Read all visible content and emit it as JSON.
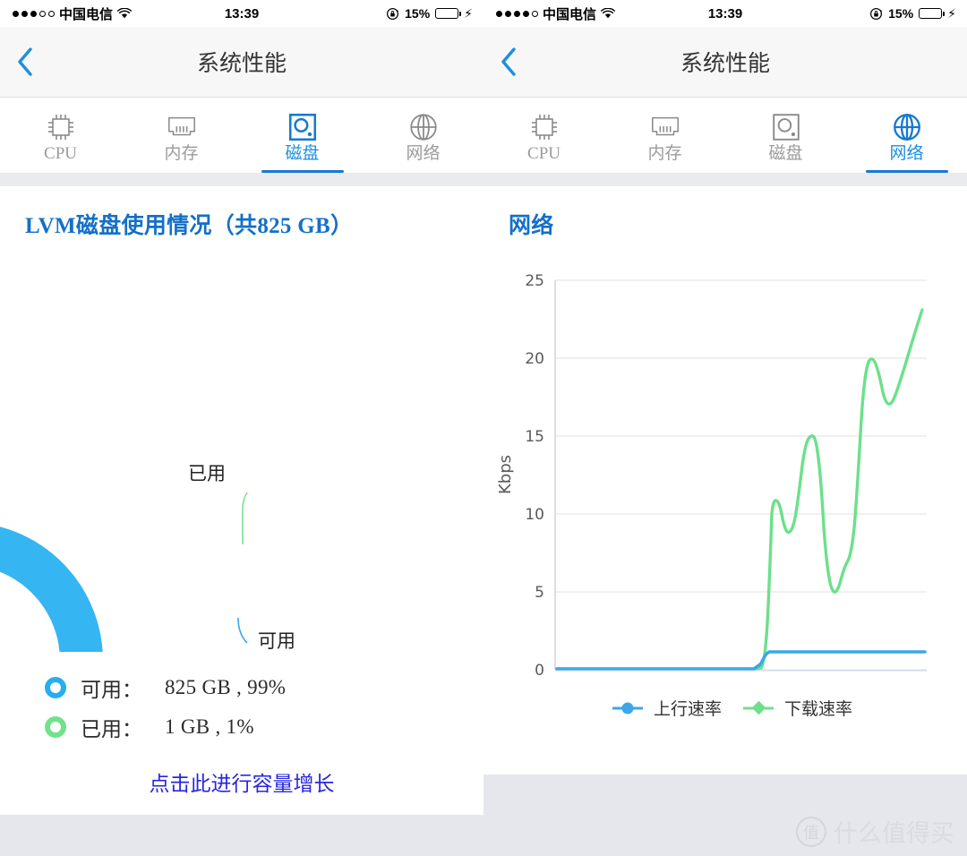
{
  "left": {
    "statusbar": {
      "signal_dots_filled": 3,
      "signal_dots_total": 5,
      "carrier": "中国电信",
      "wifi_icon": "wifi-icon",
      "time": "13:39",
      "rotation_lock_icon": "rotation-lock-icon",
      "battery_percent": "15%",
      "battery_level": 15,
      "charging_icon": "lightning-bolt-icon"
    },
    "nav": {
      "back_icon": "chevron-left-icon",
      "title": "系统性能"
    },
    "tabs": [
      {
        "label": "CPU",
        "icon": "cpu-chip-icon",
        "active": false
      },
      {
        "label": "内存",
        "icon": "memory-stick-icon",
        "active": false
      },
      {
        "label": "磁盘",
        "icon": "disk-platter-icon",
        "active": true
      },
      {
        "label": "网络",
        "icon": "globe-icon",
        "active": false
      }
    ],
    "section_title": "LVM磁盘使用情况（共825 GB）",
    "donut_labels": {
      "used": "已用",
      "free": "可用"
    },
    "legend": [
      {
        "color": "#28AEF0",
        "name": "可用：",
        "value": "825 GB , 99%"
      },
      {
        "color": "#71E28B",
        "name": "已用：",
        "value": "1 GB , 1%"
      }
    ],
    "grow_link": "点击此进行容量增长",
    "chart_data": {
      "type": "pie",
      "title": "LVM磁盘使用情况（共825 GB）",
      "labels": [
        "可用",
        "已用"
      ],
      "values": [
        99,
        1
      ],
      "value_labels": [
        "825 GB , 99%",
        "1 GB , 1%"
      ],
      "colors": [
        "#28AEF0",
        "#71E28B"
      ],
      "total": "825 GB",
      "legend_position": "bottom-left",
      "donut": true
    }
  },
  "right": {
    "statusbar": {
      "signal_dots_filled": 4,
      "signal_dots_total": 5,
      "carrier": "中国电信",
      "wifi_icon": "wifi-icon",
      "time": "13:39",
      "rotation_lock_icon": "rotation-lock-icon",
      "battery_percent": "15%",
      "battery_level": 15,
      "charging_icon": "lightning-bolt-icon"
    },
    "nav": {
      "back_icon": "chevron-left-icon",
      "title": "系统性能"
    },
    "tabs": [
      {
        "label": "CPU",
        "icon": "cpu-chip-icon",
        "active": false
      },
      {
        "label": "内存",
        "icon": "memory-stick-icon",
        "active": false
      },
      {
        "label": "磁盘",
        "icon": "disk-platter-icon",
        "active": false
      },
      {
        "label": "网络",
        "icon": "globe-icon",
        "active": true
      }
    ],
    "section_title": "网络",
    "chart_data": {
      "type": "line",
      "title": "网络",
      "ylabel": "Kbps",
      "xlabel": "",
      "ylim": [
        0,
        25
      ],
      "yticks": [
        0,
        5,
        10,
        15,
        20,
        25
      ],
      "grid": true,
      "legend_position": "bottom",
      "series": [
        {
          "name": "上行速率",
          "color": "#3BA7EA",
          "marker": "circle",
          "x": [
            0,
            10,
            20,
            30,
            40,
            50,
            55,
            58,
            62,
            70,
            80,
            90,
            100
          ],
          "values": [
            0,
            0,
            0,
            0,
            0,
            0,
            0,
            0.4,
            1.1,
            1.1,
            1.1,
            1.1,
            1.1
          ]
        },
        {
          "name": "下载速率",
          "color": "#6CE08B",
          "marker": "diamond",
          "x": [
            0,
            10,
            20,
            30,
            40,
            50,
            55,
            58,
            62,
            66,
            70,
            74,
            78,
            82,
            86,
            90,
            94,
            97,
            100
          ],
          "values": [
            0,
            0,
            0,
            0,
            0,
            0,
            0,
            0.2,
            10.0,
            8.2,
            10.5,
            15.0,
            7.0,
            5.0,
            6.6,
            20.0,
            18.3,
            19.5,
            21.0
          ]
        }
      ]
    },
    "watermark": {
      "badge": "值",
      "text": "什么值得买"
    }
  }
}
